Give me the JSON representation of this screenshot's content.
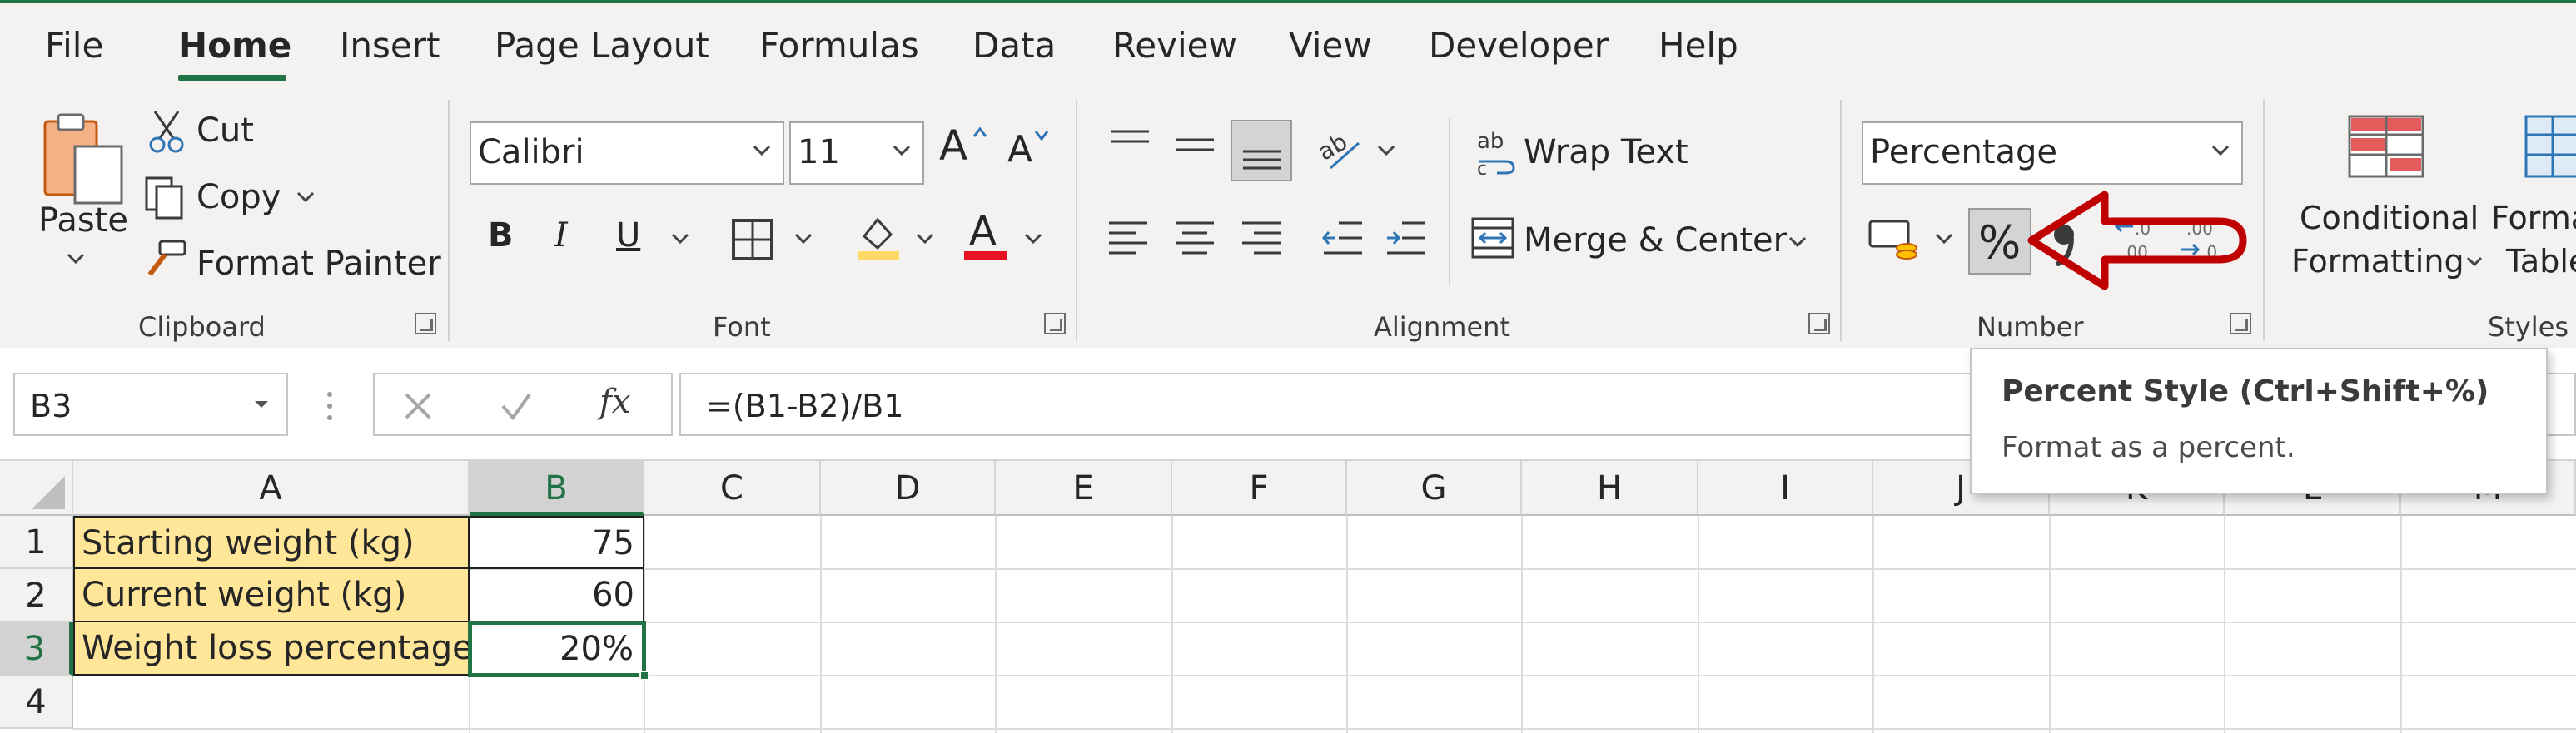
{
  "tabs": [
    "File",
    "Home",
    "Insert",
    "Page Layout",
    "Formulas",
    "Data",
    "Review",
    "View",
    "Developer",
    "Help"
  ],
  "active_tab": "Home",
  "clipboard": {
    "paste": "Paste",
    "cut": "Cut",
    "copy": "Copy",
    "format_painter": "Format Painter",
    "group": "Clipboard"
  },
  "font": {
    "name": "Calibri",
    "size": "11",
    "group": "Font",
    "bold": "B",
    "italic": "I",
    "underline": "U",
    "font_color": "A",
    "grow": "A",
    "shrink": "A"
  },
  "alignment": {
    "wrap_text": "Wrap Text",
    "merge_center": "Merge & Center",
    "group": "Alignment"
  },
  "number": {
    "format": "Percentage",
    "percent_symbol": "%",
    "group": "Number"
  },
  "styles": {
    "conditional_line1": "Conditional",
    "conditional_line2": "Formatting",
    "format_table_line1": "Forma",
    "format_table_line2": "Table",
    "group": "Styles"
  },
  "formula_bar": {
    "name_box": "B3",
    "fx": "fx",
    "formula": "=(B1-B2)/B1"
  },
  "tooltip": {
    "title": "Percent Style (Ctrl+Shift+%)",
    "description": "Format as a percent."
  },
  "sheet": {
    "columns": [
      "A",
      "B",
      "C",
      "D",
      "E",
      "F",
      "G",
      "H",
      "I",
      "J",
      "K",
      "L",
      "M"
    ],
    "rows": [
      "1",
      "2",
      "3",
      "4"
    ],
    "cells": {
      "A1": "Starting weight (kg)",
      "B1": "75",
      "A2": "Current weight (kg)",
      "B2": "60",
      "A3": "Weight loss percentage",
      "B3": "20%"
    }
  },
  "colors": {
    "accent": "#217346",
    "label_fill": "#ffe699",
    "annotation_arrow": "#c00000",
    "font_color_bar": "#e81123",
    "highlight_bar": "#ffd966"
  }
}
